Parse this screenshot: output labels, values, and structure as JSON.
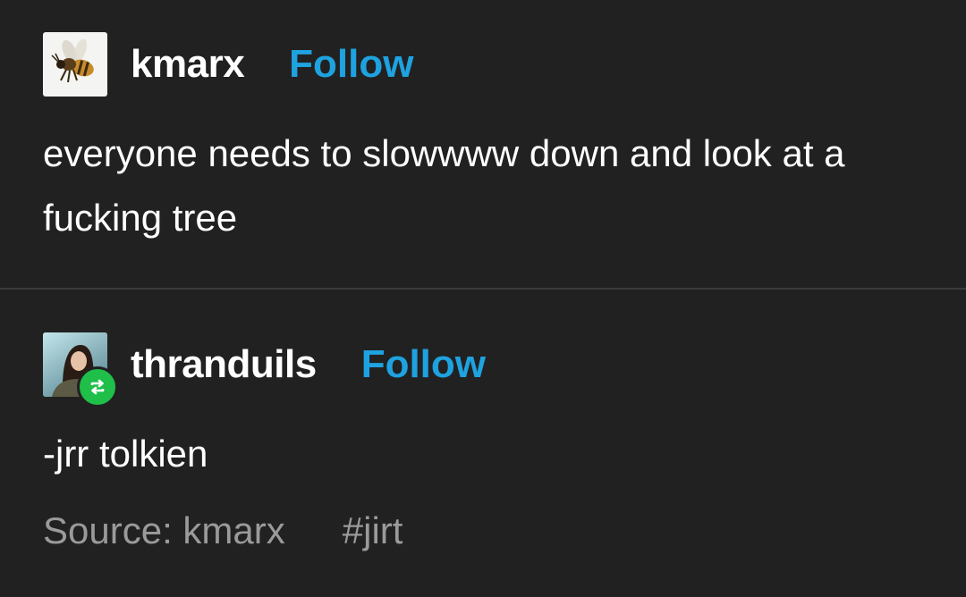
{
  "posts": [
    {
      "username": "kmarx",
      "follow_label": "Follow",
      "body": "everyone needs to slowwww down and look at a fucking tree",
      "avatar_icon": "bee-icon"
    },
    {
      "username": "thranduils",
      "follow_label": "Follow",
      "body": "-jrr tolkien",
      "avatar_icon": "avatar-photo",
      "badge_icon": "reblog-icon",
      "source_label": "Source:",
      "source_user": "kmarx",
      "tag": "#jirt"
    }
  ],
  "colors": {
    "background": "#212121",
    "follow": "#1ea2e0",
    "reblog_badge": "#1fbf4a",
    "muted": "#9a9a9a"
  }
}
